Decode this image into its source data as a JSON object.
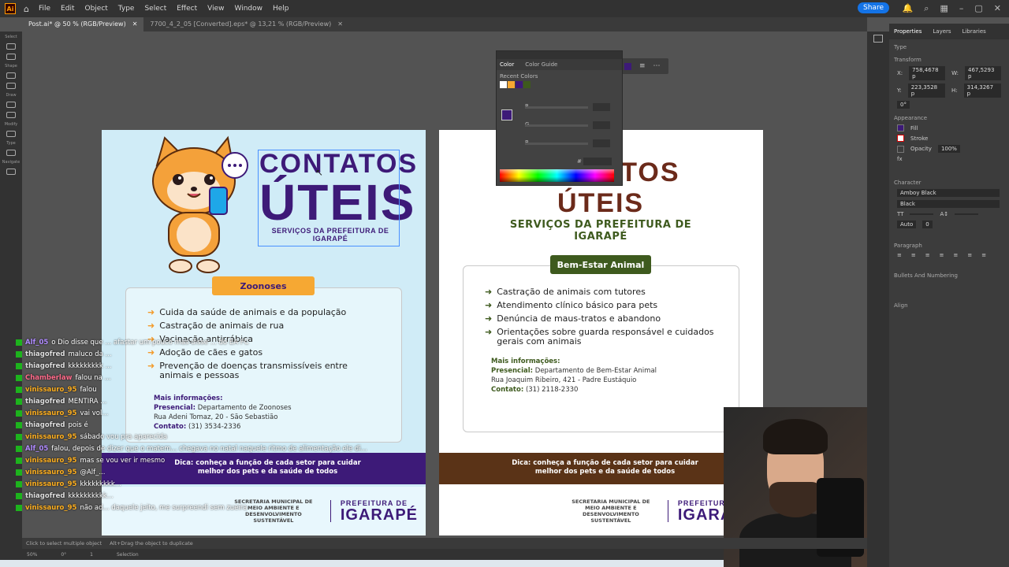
{
  "app": {
    "logo": "Ai",
    "home_icon": "home-icon"
  },
  "menu": [
    "File",
    "Edit",
    "Object",
    "Type",
    "Select",
    "Effect",
    "View",
    "Window",
    "Help"
  ],
  "share_label": "Share",
  "tabs": [
    {
      "label": "Post.ai* @ 50 % (RGB/Preview)",
      "active": true
    },
    {
      "label": "7700_4_2_05 [Converted].eps* @ 13,21 % (RGB/Preview)",
      "active": false
    }
  ],
  "left_tool_groups": [
    "Select",
    "Shape",
    "Draw",
    "Modify",
    "Type",
    "Navigate"
  ],
  "properties": {
    "tabs": [
      "Properties",
      "Layers",
      "Libraries"
    ],
    "type_label": "Type",
    "transform_label": "Transform",
    "x_label": "X:",
    "x_value": "758,4678 p",
    "y_label": "Y:",
    "y_value": "223,3528 p",
    "w_label": "W:",
    "w_value": "467,5293 p",
    "h_label": "H:",
    "h_value": "314,3267 p",
    "angle_value": "0°",
    "appearance_label": "Appearance",
    "fill_label": "Fill",
    "fill_color": "#3d1a78",
    "stroke_label": "Stroke",
    "opacity_label": "Opacity",
    "opacity_value": "100%",
    "fx_label": "fx",
    "character_label": "Character",
    "font_name": "Amboy Black",
    "font_style": "Black",
    "auto_label": "Auto",
    "tracking_value": "0",
    "paragraph_label": "Paragraph",
    "bullets_label": "Bullets And Numbering",
    "align_label": "Align"
  },
  "color_panel": {
    "tabs": [
      "Color",
      "Color Guide"
    ],
    "recent_label": "Recent Colors",
    "channels": [
      "R",
      "G",
      "B"
    ],
    "hex_label": "#"
  },
  "artboard1": {
    "title_line1": "CONTATOS",
    "title_line2": "ÚTEIS",
    "subtitle": "SERVIÇOS DA PREFEITURA DE IGARAPÉ",
    "pill": "Zoonoses",
    "items": [
      "Cuida da saúde de animais e da população",
      "Castração de animais de rua",
      "Vacinação antirrábica",
      "Adoção de cães e gatos",
      "Prevenção de doenças transmissíveis entre animais e pessoas"
    ],
    "info_title": "Mais informações:",
    "info_presencial_label": "Presencial:",
    "info_presencial": "Departamento de Zoonoses",
    "info_address": "Rua Adeni Tomaz, 20 - São Sebastião",
    "info_contato_label": "Contato:",
    "info_contato": "(31) 3534-2336",
    "tip": "Dica: conheça a função de cada setor para cuidar melhor dos pets e da saúde de todos",
    "secretaria": "SECRETARIA MUNICIPAL DE MEIO AMBIENTE E DESENVOLVIMENTO SUSTENTÁVEL",
    "pref_line1": "PREFEITURA DE",
    "pref_line2": "IGARAPÉ",
    "band_color": "#3d1a78",
    "pill_color": "#f6a833"
  },
  "artboard2": {
    "title_line1": "CONTATOS ÚTEIS",
    "subtitle": "SERVIÇOS DA PREFEITURA DE IGARAPÉ",
    "pill": "Bem-Estar Animal",
    "items": [
      "Castração de animais com tutores",
      "Atendimento clínico básico para pets",
      "Denúncia de maus-tratos e abandono",
      "Orientações sobre guarda responsável e cuidados gerais com animais"
    ],
    "info_title": "Mais informações:",
    "info_presencial_label": "Presencial:",
    "info_presencial": "Departamento de Bem-Estar Animal",
    "info_address": "Rua Joaquim Ribeiro, 421 - Padre Eustáquio",
    "info_contato_label": "Contato:",
    "info_contato": "(31) 2118-2330",
    "tip": "Dica: conheça a função de cada setor para cuidar melhor dos pets e da saúde de todos",
    "secretaria": "SECRETARIA MUNICIPAL DE MEIO AMBIENTE E DESENVOLVIMENTO SUSTENTÁVEL",
    "pref_line1": "PREFEITURA DE",
    "pref_line2": "IGARAPÉ",
    "band_color": "#5a3317",
    "pill_color": "#3e5a1e"
  },
  "chat": [
    {
      "user": "Alf_05",
      "color": "#b18cff",
      "msg": "o Dio disse que ... afastar um pouco mas disse ... do EA FC"
    },
    {
      "user": "thiagofred",
      "color": "#e0e0e0",
      "msg": "maluco da ..."
    },
    {
      "user": "thiagofred",
      "color": "#e0e0e0",
      "msg": "kkkkkkkkk ..."
    },
    {
      "user": "Chamberlaw",
      "color": "#ff6b8a",
      "msg": "falou na ..."
    },
    {
      "user": "vinissauro_95",
      "color": "#ffb020",
      "msg": "falou"
    },
    {
      "user": "thiagofred",
      "color": "#e0e0e0",
      "msg": "MENTIRA ..."
    },
    {
      "user": "vinissauro_95",
      "color": "#ffb020",
      "msg": "vai vol..."
    },
    {
      "user": "thiagofred",
      "color": "#e0e0e0",
      "msg": "pois é"
    },
    {
      "user": "vinissauro_95",
      "color": "#ffb020",
      "msg": "sábado vou pra aparecida"
    },
    {
      "user": "Alf_05",
      "color": "#b18cff",
      "msg": "falou, depois de dizer que o matem... chegava no natal naquele ritmo de alimentação ele di..."
    },
    {
      "user": "vinissauro_95",
      "color": "#ffb020",
      "msg": "mas se vou ver ir mesmo"
    },
    {
      "user": "vinissauro_95",
      "color": "#ffb020",
      "msg": "@Alf_..."
    },
    {
      "user": "vinissauro_95",
      "color": "#ffb020",
      "msg": "kkkkkkkkk..."
    },
    {
      "user": "thiagofred",
      "color": "#e0e0e0",
      "msg": "kkkkkkkkkk..."
    },
    {
      "user": "vinissauro_95",
      "color": "#ffb020",
      "msg": "não ad... daquele jeito, me surpreendi sem zueira"
    }
  ],
  "status": {
    "tip1": "Click to select multiple object",
    "tip2": "Alt+Drag the object to duplicate"
  },
  "bottom": {
    "zoom": "50%",
    "angle": "0°",
    "artboard_num": "1",
    "mode": "Selection"
  }
}
